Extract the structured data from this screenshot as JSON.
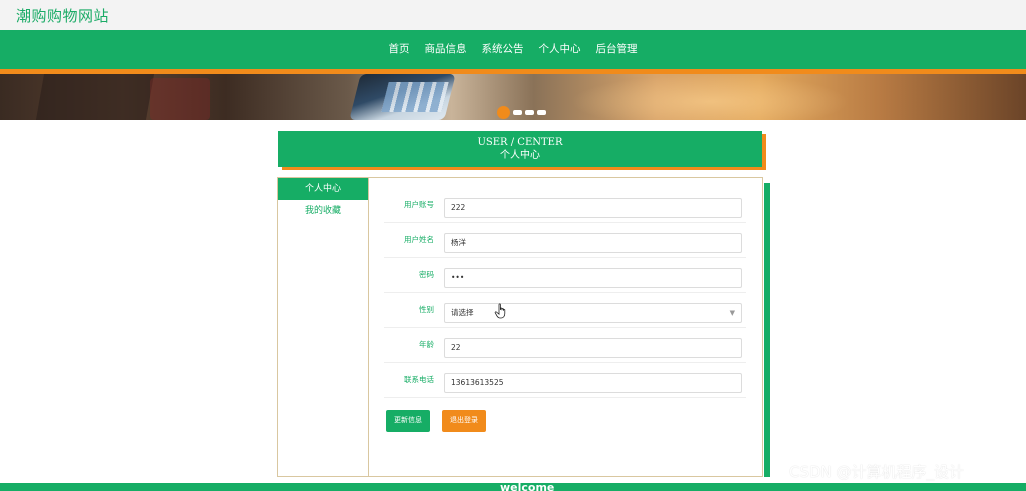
{
  "site": {
    "title": "潮购购物网站"
  },
  "nav": {
    "items": [
      "首页",
      "商品信息",
      "系统公告",
      "个人中心",
      "后台管理"
    ]
  },
  "banner": {
    "dots": 4,
    "active_dot": 0
  },
  "user_center": {
    "title_en": "USER / CENTER",
    "title_cn": "个人中心"
  },
  "sidebar": {
    "items": [
      {
        "label": "个人中心",
        "active": true
      },
      {
        "label": "我的收藏",
        "active": false
      }
    ]
  },
  "form": {
    "fields": [
      {
        "label": "用户账号",
        "value": "222",
        "type": "text"
      },
      {
        "label": "用户姓名",
        "value": "杨洋",
        "type": "text"
      },
      {
        "label": "密码",
        "value": "•••",
        "type": "password"
      },
      {
        "label": "性别",
        "value": "请选择",
        "type": "select"
      },
      {
        "label": "年龄",
        "value": "22",
        "type": "text"
      },
      {
        "label": "联系电话",
        "value": "13613613525",
        "type": "text"
      }
    ],
    "update_button": "更新信息",
    "logout_button": "退出登录"
  },
  "footer": {
    "text": "welcome"
  },
  "watermark": "CSDN @计算机程序_设计",
  "colors": {
    "primary": "#16ad65",
    "accent": "#f18b1b"
  }
}
